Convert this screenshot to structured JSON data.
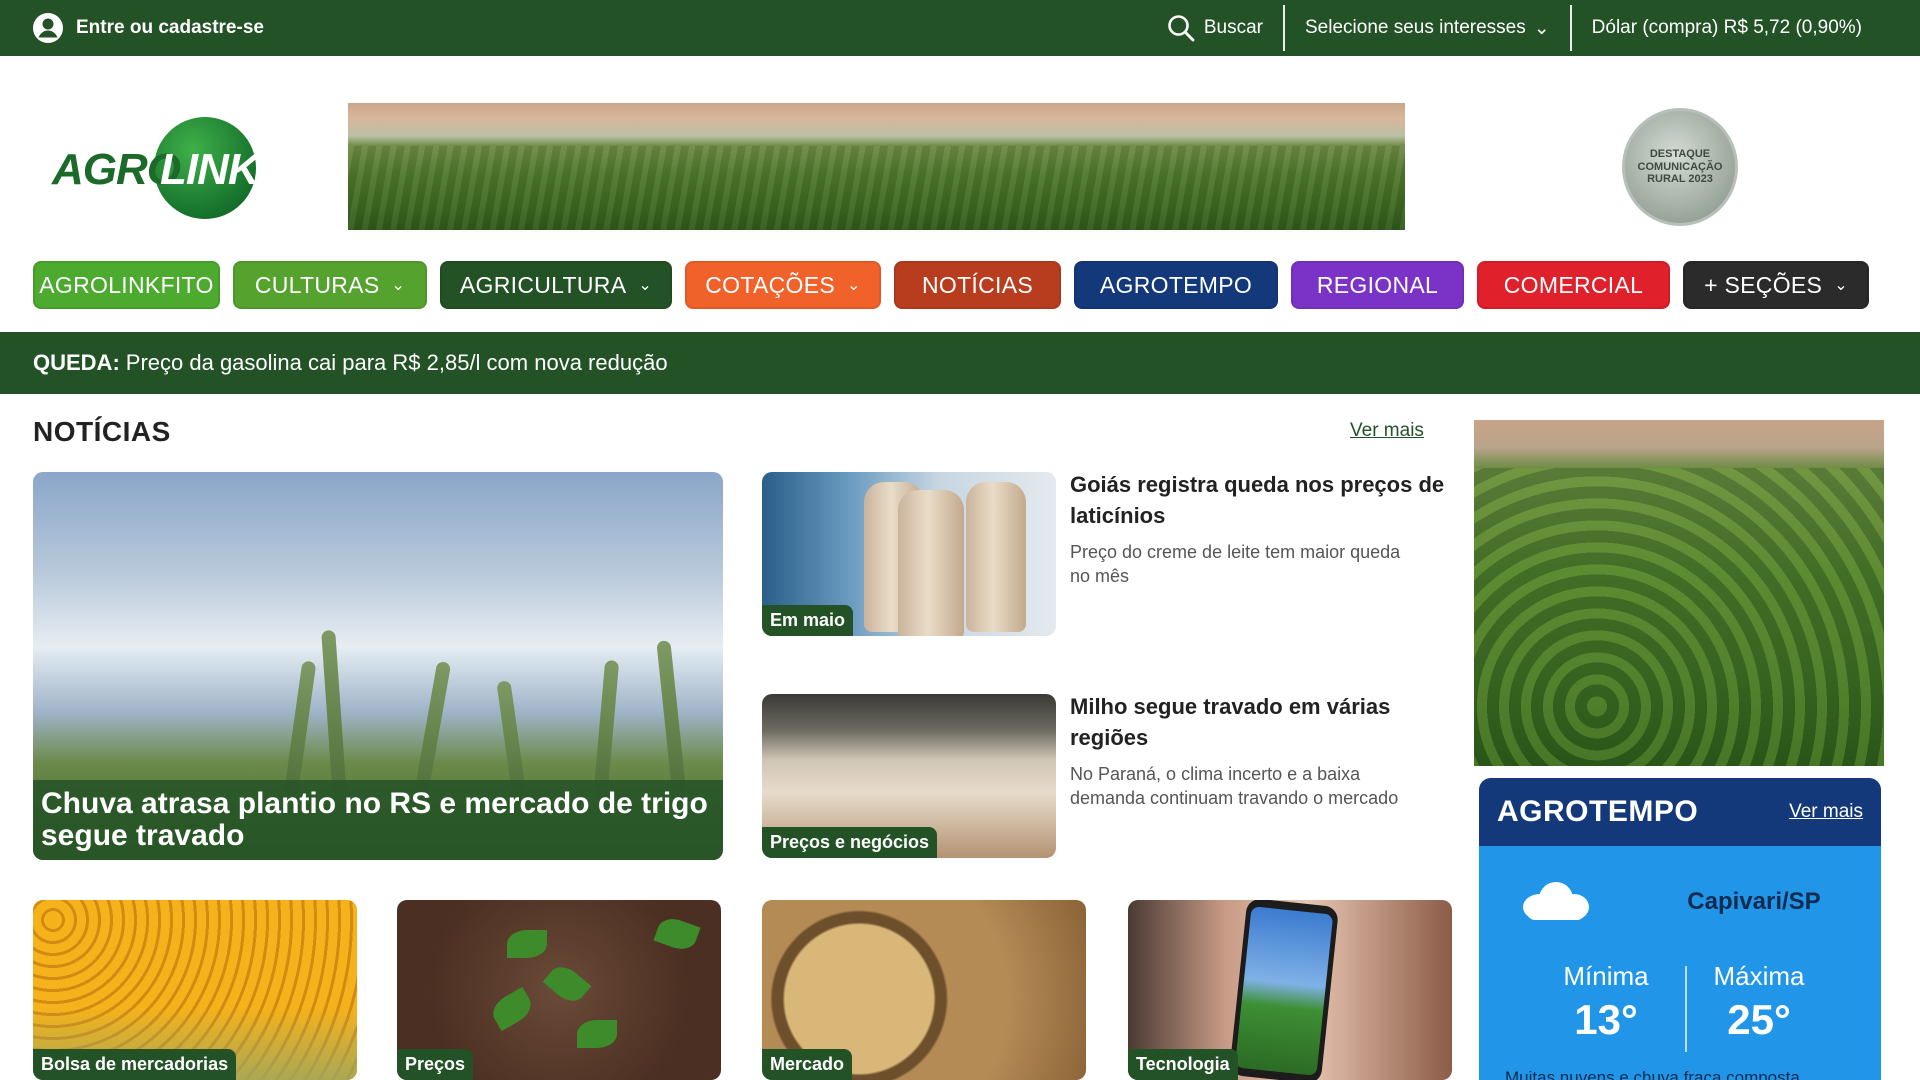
{
  "topbar": {
    "login_label": "Entre ou cadastre-se",
    "search_label": "Buscar",
    "interests_label": "Selecione seus interesses",
    "dollar_label": "Dólar (compra) R$ 5,72 (0,90%)"
  },
  "logo": {
    "part1": "AGRO",
    "part2": "LINK"
  },
  "seal": {
    "text": "DESTAQUE COMUNICAÇÃO RURAL 2023"
  },
  "nav": {
    "items": [
      {
        "label": "AGROLINKFITO",
        "color": "#4caa2f",
        "chevron": false,
        "width": 187
      },
      {
        "label": "CULTURAS",
        "color": "#55a22e",
        "chevron": true,
        "width": 194
      },
      {
        "label": "AGRICULTURA",
        "color": "#245227",
        "chevron": true,
        "width": 232
      },
      {
        "label": "COTAÇÕES",
        "color": "#f0622a",
        "chevron": true,
        "width": 196
      },
      {
        "label": "NOTÍCIAS",
        "color": "#b83d1f",
        "chevron": false,
        "width": 167
      },
      {
        "label": "AGROTEMPO",
        "color": "#14397a",
        "chevron": false,
        "width": 204
      },
      {
        "label": "REGIONAL",
        "color": "#7b33c7",
        "chevron": false,
        "width": 173
      },
      {
        "label": "COMERCIAL",
        "color": "#e0202b",
        "chevron": false,
        "width": 193
      },
      {
        "label": "+ SEÇÕES",
        "color": "#2b2b2b",
        "chevron": true,
        "width": 186
      }
    ]
  },
  "ticker": {
    "label": "QUEDA:",
    "text": "Preço da gasolina cai para R$ 2,85/l com nova redução"
  },
  "news": {
    "section_title": "NOTÍCIAS",
    "ver_mais": "Ver mais",
    "hero": {
      "title": "Chuva atrasa plantio no RS e mercado de trigo segue travado"
    },
    "stories": [
      {
        "tag": "Em maio",
        "title": "Goiás registra queda nos preços de laticínios",
        "subtitle": "Preço do creme de leite tem maior queda no mês"
      },
      {
        "tag": "Preços e negócios",
        "title": "Milho segue travado em várias regiões",
        "subtitle": "No Paraná, o clima incerto e a baixa demanda continuam travando o mercado"
      }
    ],
    "small_cards": [
      {
        "tag": "Bolsa de mercadorias"
      },
      {
        "tag": "Preços"
      },
      {
        "tag": "Mercado"
      },
      {
        "tag": "Tecnologia"
      }
    ]
  },
  "agrotempo": {
    "title": "AGROTEMPO",
    "ver_mais": "Ver mais",
    "city": "Capivari/SP",
    "min_label": "Mínima",
    "min_value": "13°",
    "max_label": "Máxima",
    "max_value": "25°",
    "forecast": "Muitas nuvens e chuva fraca composta"
  }
}
